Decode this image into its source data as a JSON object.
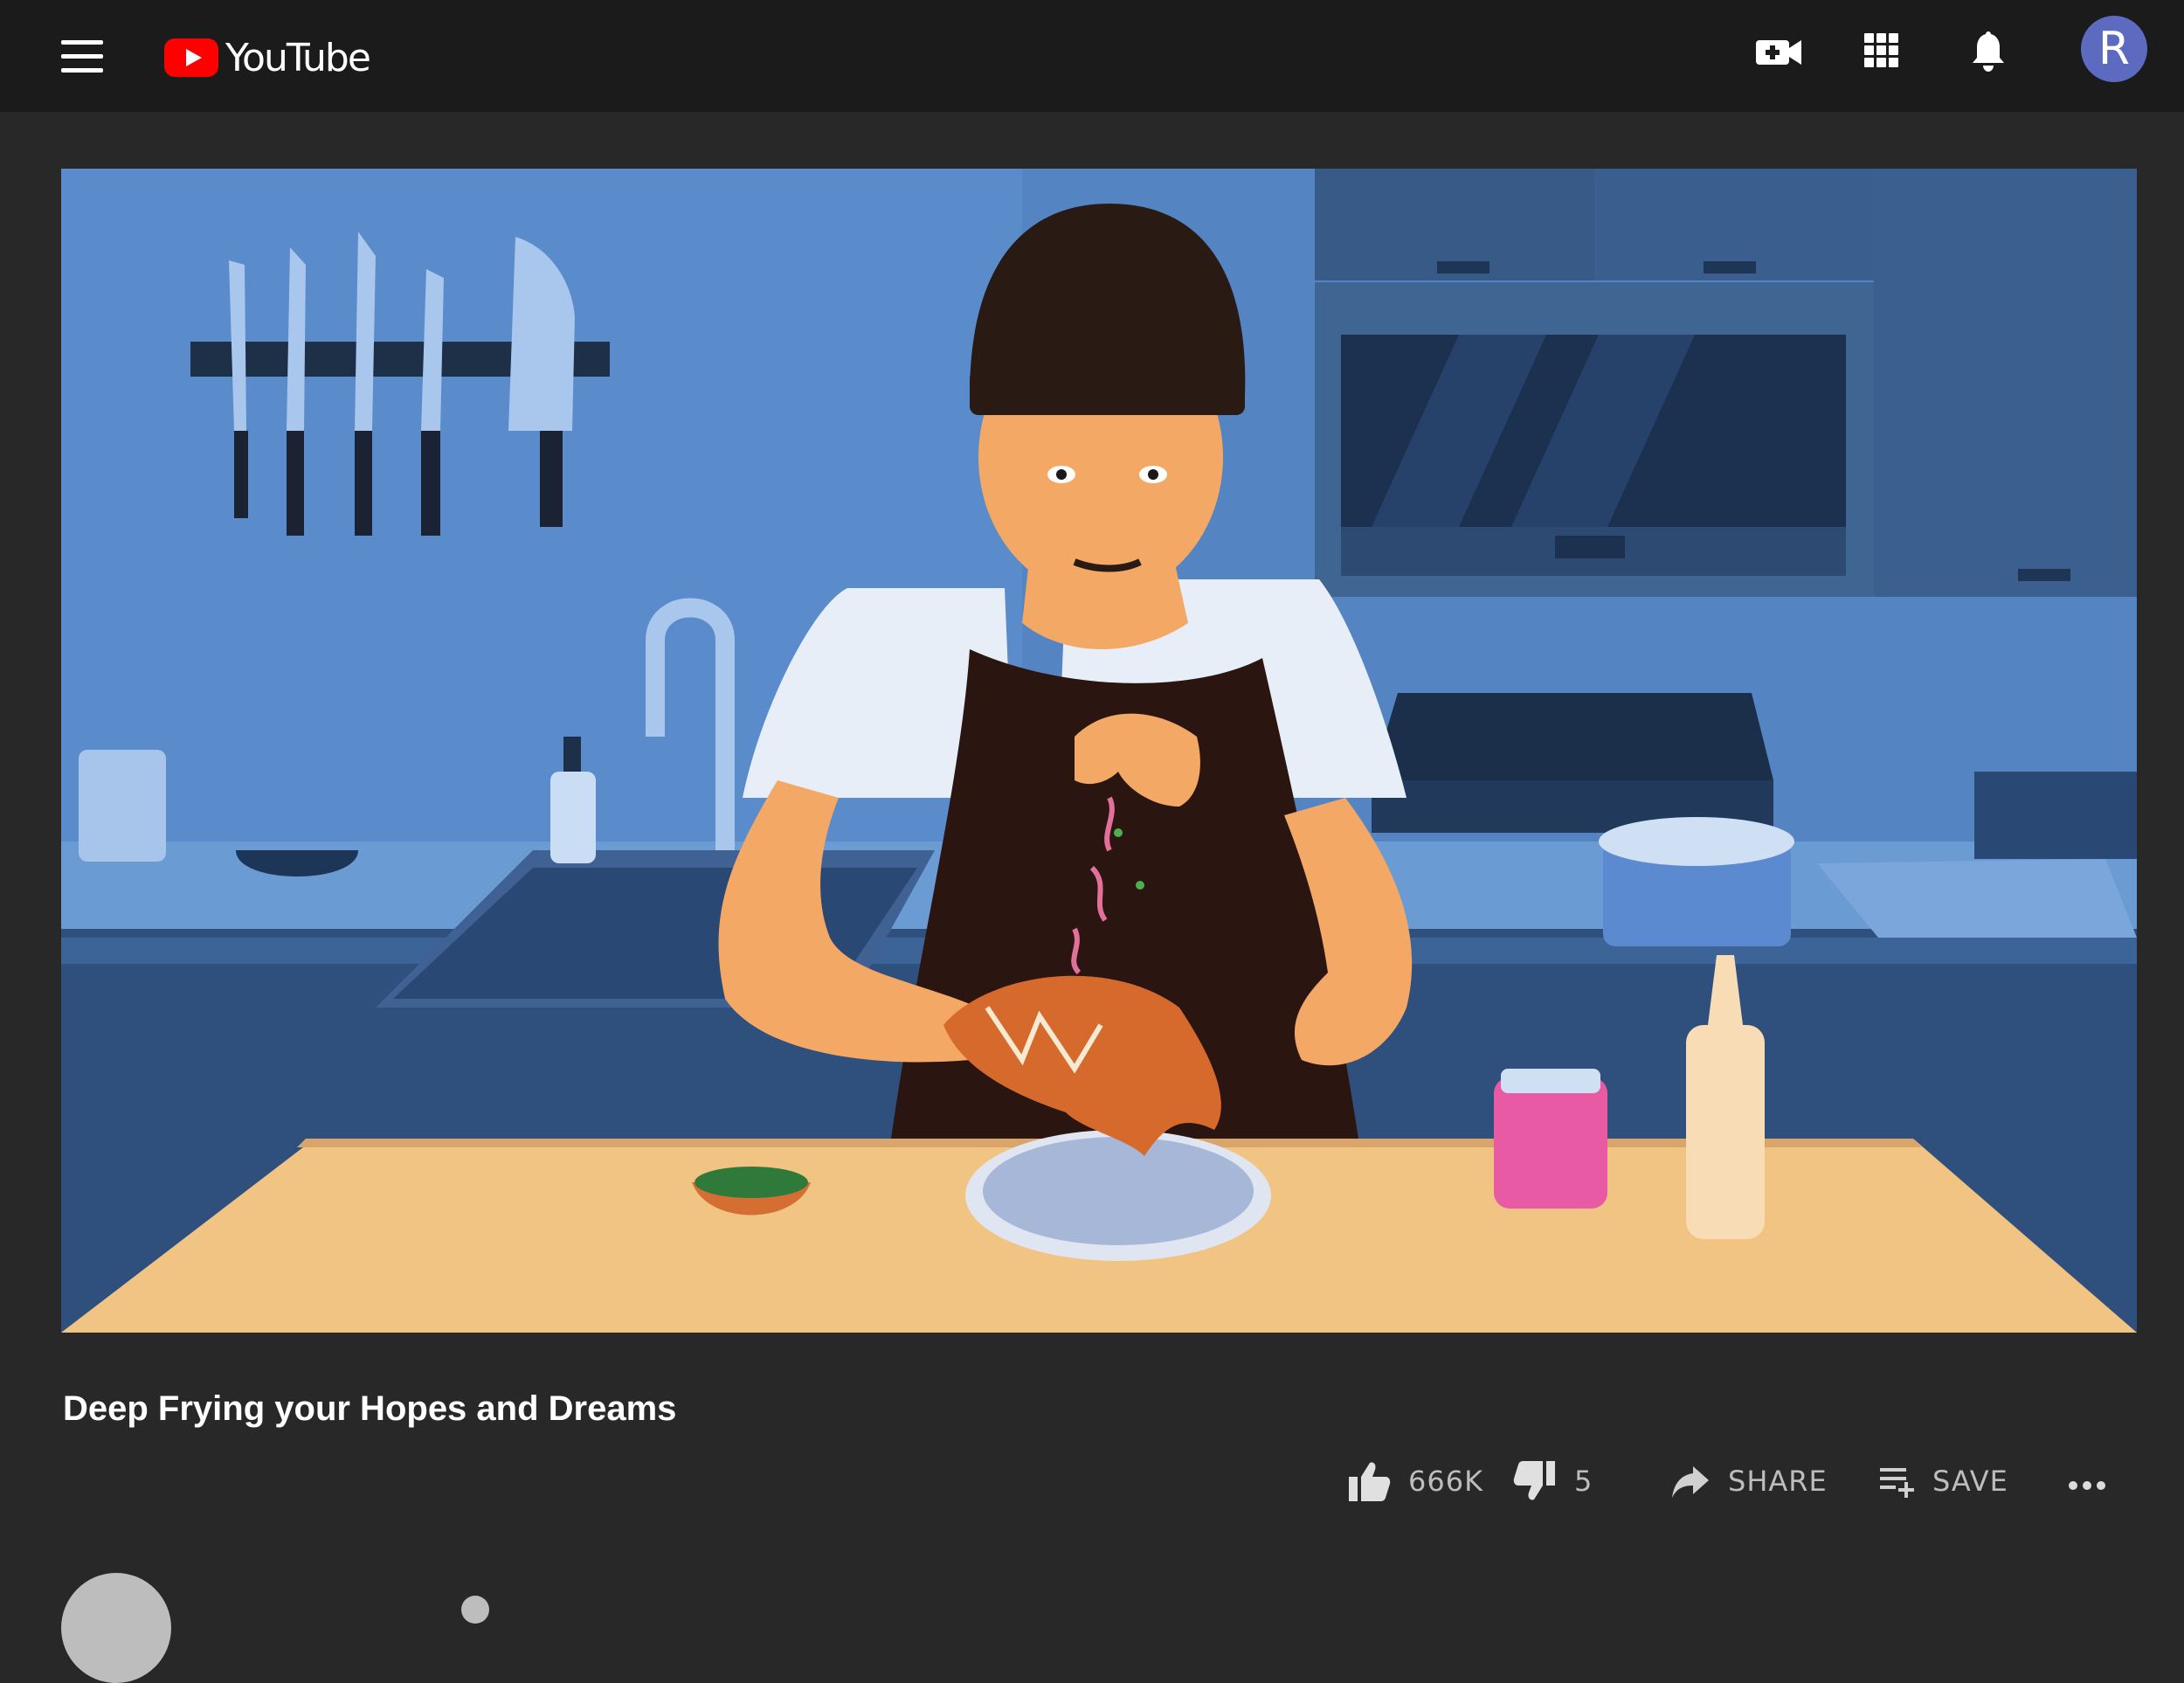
{
  "app": {
    "brand": "YouTube"
  },
  "header": {
    "avatar_letter": "R",
    "icons": [
      "menu-icon",
      "create-video-icon",
      "apps-grid-icon",
      "notifications-bell-icon"
    ]
  },
  "video": {
    "title": "Deep Frying your Hopes and Dreams"
  },
  "actions": {
    "like_count": "666K",
    "dislike_count": "5",
    "share_label": "SHARE",
    "save_label": "SAVE"
  },
  "colors": {
    "topbar": "#1b1b1b",
    "page_bg": "#282828",
    "brand_red": "#ff0000",
    "avatar_bg": "#5c6bc0"
  }
}
